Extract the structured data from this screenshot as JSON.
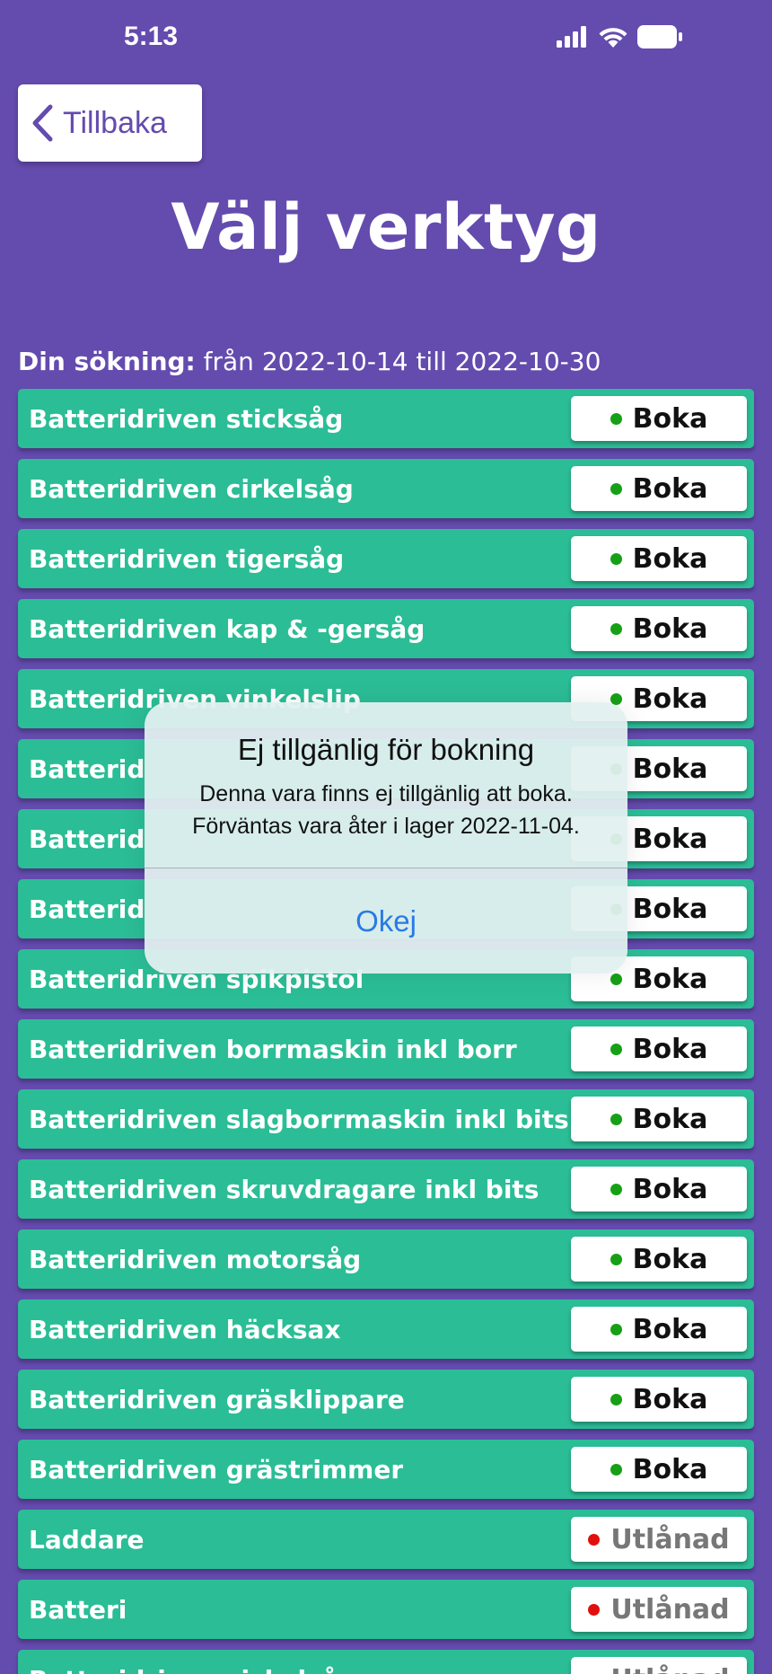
{
  "status_bar": {
    "time": "5:13"
  },
  "header": {
    "back_label": "Tillbaka",
    "title": "Välj verktyg"
  },
  "search": {
    "label": "Din sökning:",
    "range_text": " från 2022-10-14 till 2022-10-30"
  },
  "colors": {
    "background": "#644bae",
    "row": "#2bbd96",
    "available_dot": "#16a016",
    "unavailable_dot": "#e0100e",
    "link_blue": "#2a7ae6"
  },
  "tools": [
    {
      "name": "Batteridriven sticksåg",
      "action": "Boka",
      "available": true
    },
    {
      "name": "Batteridriven cirkelsåg",
      "action": "Boka",
      "available": true
    },
    {
      "name": "Batteridriven tigersåg",
      "action": "Boka",
      "available": true
    },
    {
      "name": "Batteridriven kap & -gersåg",
      "action": "Boka",
      "available": true
    },
    {
      "name": "Batteridriven vinkelslip",
      "action": "Boka",
      "available": true
    },
    {
      "name": "Batterid",
      "action": "Boka",
      "available": true
    },
    {
      "name": "Batterid",
      "action": "Boka",
      "available": true
    },
    {
      "name": "Batterid",
      "action": "Boka",
      "available": true
    },
    {
      "name": "Batteridriven spikpistol",
      "action": "Boka",
      "available": true
    },
    {
      "name": "Batteridriven borrmaskin inkl borr",
      "action": "Boka",
      "available": true
    },
    {
      "name": "Batteridriven slagborrmaskin inkl bits",
      "action": "Boka",
      "available": true
    },
    {
      "name": "Batteridriven skruvdragare inkl bits",
      "action": "Boka",
      "available": true
    },
    {
      "name": "Batteridriven motorsåg",
      "action": "Boka",
      "available": true
    },
    {
      "name": "Batteridriven häcksax",
      "action": "Boka",
      "available": true
    },
    {
      "name": "Batteridriven gräsklippare",
      "action": "Boka",
      "available": true
    },
    {
      "name": "Batteridriven grästrimmer",
      "action": "Boka",
      "available": true
    },
    {
      "name": "Laddare",
      "action": "Utlånad",
      "available": false
    },
    {
      "name": "Batteri",
      "action": "Utlånad",
      "available": false
    },
    {
      "name": "Batteridriven sickelsåg",
      "action": "Utlånad",
      "available": false
    }
  ],
  "alert": {
    "title": "Ej tillgänlig för bokning",
    "line1": "Denna vara finns ej tillgänlig att boka.",
    "line2": "Förväntas vara åter i lager 2022-11-04.",
    "ok_label": "Okej"
  }
}
